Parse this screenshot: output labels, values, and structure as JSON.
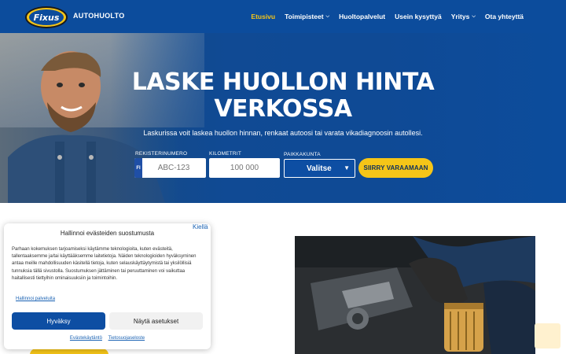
{
  "header": {
    "logo_text": "Fixus",
    "brand": "AUTOHUOLTO",
    "nav": [
      {
        "label": "Etusivu",
        "active": true,
        "has_dropdown": false
      },
      {
        "label": "Toimipisteet",
        "active": false,
        "has_dropdown": true
      },
      {
        "label": "Huoltopalvelut",
        "active": false,
        "has_dropdown": false
      },
      {
        "label": "Usein kysyttyä",
        "active": false,
        "has_dropdown": false
      },
      {
        "label": "Yritys",
        "active": false,
        "has_dropdown": true
      },
      {
        "label": "Ota yhteyttä",
        "active": false,
        "has_dropdown": false
      }
    ]
  },
  "hero": {
    "title_line1": "LASKE HUOLLON HINTA",
    "title_line2": "VERKOSSA",
    "subtitle": "Laskurissa voit laskea huollon hinnan, renkaat autoosi tai varata vikadiagnoosin autollesi.",
    "form": {
      "reg_label": "REKISTERINUMERO",
      "reg_prefix": "FI",
      "reg_placeholder": "ABC-123",
      "km_label": "KILOMETRIT",
      "km_placeholder": "100 000",
      "location_label": "PAIKKAKUNTA",
      "location_value": "Valitse",
      "submit_label": "SIIRRY VARAAMAAN"
    }
  },
  "cookie": {
    "close_label": "Kiellä",
    "title": "Hallinnoi evästeiden suostumusta",
    "text": "Parhaan kokemuksen tarjoamiseksi käytämme teknologioita, kuten evästeitä, tallentaaksemme ja/tai käyttääksemme laitetietoja. Näiden teknologioiden hyväksyminen antaa meille mahdollisuuden käsitellä tietoja, kuten selauskäyttäytymistä tai yksilöllisiä tunnuksia tällä sivustolla. Suostumuksen jättäminen tai peruuttaminen voi vaikuttaa haitallisesti tiettyihin ominaisuuksiin ja toimintoihin.",
    "manage_link": "Hallinnoi palveluita",
    "accept_label": "Hyväksy",
    "settings_label": "Näytä asetukset",
    "footer_links": [
      "Evästekäytäntö",
      "Tietosuojaseloste"
    ]
  },
  "colors": {
    "brand_blue": "#0c4c9c",
    "accent_yellow": "#f5c518"
  }
}
